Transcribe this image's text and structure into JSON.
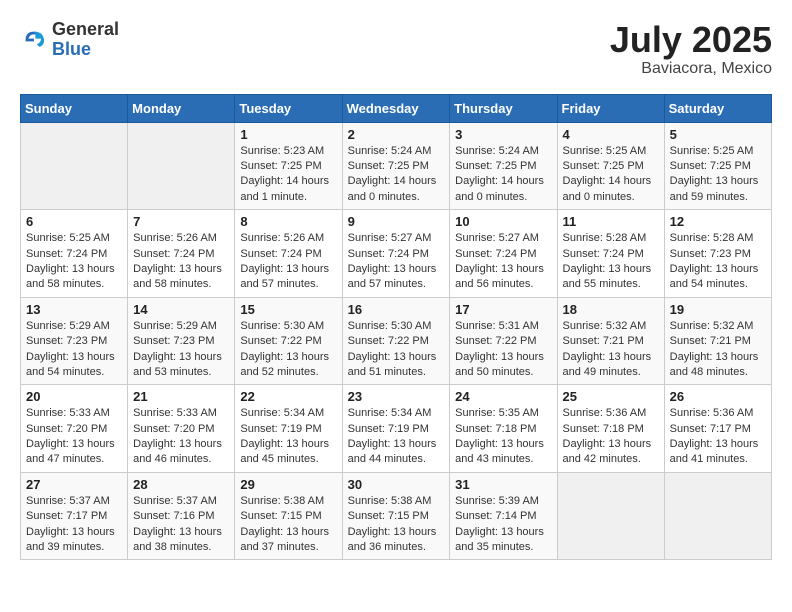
{
  "header": {
    "logo_general": "General",
    "logo_blue": "Blue",
    "title": "July 2025",
    "subtitle": "Baviacora, Mexico"
  },
  "weekdays": [
    "Sunday",
    "Monday",
    "Tuesday",
    "Wednesday",
    "Thursday",
    "Friday",
    "Saturday"
  ],
  "weeks": [
    [
      {
        "day": "",
        "info": ""
      },
      {
        "day": "",
        "info": ""
      },
      {
        "day": "1",
        "info": "Sunrise: 5:23 AM\nSunset: 7:25 PM\nDaylight: 14 hours and 1 minute."
      },
      {
        "day": "2",
        "info": "Sunrise: 5:24 AM\nSunset: 7:25 PM\nDaylight: 14 hours and 0 minutes."
      },
      {
        "day": "3",
        "info": "Sunrise: 5:24 AM\nSunset: 7:25 PM\nDaylight: 14 hours and 0 minutes."
      },
      {
        "day": "4",
        "info": "Sunrise: 5:25 AM\nSunset: 7:25 PM\nDaylight: 14 hours and 0 minutes."
      },
      {
        "day": "5",
        "info": "Sunrise: 5:25 AM\nSunset: 7:25 PM\nDaylight: 13 hours and 59 minutes."
      }
    ],
    [
      {
        "day": "6",
        "info": "Sunrise: 5:25 AM\nSunset: 7:24 PM\nDaylight: 13 hours and 58 minutes."
      },
      {
        "day": "7",
        "info": "Sunrise: 5:26 AM\nSunset: 7:24 PM\nDaylight: 13 hours and 58 minutes."
      },
      {
        "day": "8",
        "info": "Sunrise: 5:26 AM\nSunset: 7:24 PM\nDaylight: 13 hours and 57 minutes."
      },
      {
        "day": "9",
        "info": "Sunrise: 5:27 AM\nSunset: 7:24 PM\nDaylight: 13 hours and 57 minutes."
      },
      {
        "day": "10",
        "info": "Sunrise: 5:27 AM\nSunset: 7:24 PM\nDaylight: 13 hours and 56 minutes."
      },
      {
        "day": "11",
        "info": "Sunrise: 5:28 AM\nSunset: 7:24 PM\nDaylight: 13 hours and 55 minutes."
      },
      {
        "day": "12",
        "info": "Sunrise: 5:28 AM\nSunset: 7:23 PM\nDaylight: 13 hours and 54 minutes."
      }
    ],
    [
      {
        "day": "13",
        "info": "Sunrise: 5:29 AM\nSunset: 7:23 PM\nDaylight: 13 hours and 54 minutes."
      },
      {
        "day": "14",
        "info": "Sunrise: 5:29 AM\nSunset: 7:23 PM\nDaylight: 13 hours and 53 minutes."
      },
      {
        "day": "15",
        "info": "Sunrise: 5:30 AM\nSunset: 7:22 PM\nDaylight: 13 hours and 52 minutes."
      },
      {
        "day": "16",
        "info": "Sunrise: 5:30 AM\nSunset: 7:22 PM\nDaylight: 13 hours and 51 minutes."
      },
      {
        "day": "17",
        "info": "Sunrise: 5:31 AM\nSunset: 7:22 PM\nDaylight: 13 hours and 50 minutes."
      },
      {
        "day": "18",
        "info": "Sunrise: 5:32 AM\nSunset: 7:21 PM\nDaylight: 13 hours and 49 minutes."
      },
      {
        "day": "19",
        "info": "Sunrise: 5:32 AM\nSunset: 7:21 PM\nDaylight: 13 hours and 48 minutes."
      }
    ],
    [
      {
        "day": "20",
        "info": "Sunrise: 5:33 AM\nSunset: 7:20 PM\nDaylight: 13 hours and 47 minutes."
      },
      {
        "day": "21",
        "info": "Sunrise: 5:33 AM\nSunset: 7:20 PM\nDaylight: 13 hours and 46 minutes."
      },
      {
        "day": "22",
        "info": "Sunrise: 5:34 AM\nSunset: 7:19 PM\nDaylight: 13 hours and 45 minutes."
      },
      {
        "day": "23",
        "info": "Sunrise: 5:34 AM\nSunset: 7:19 PM\nDaylight: 13 hours and 44 minutes."
      },
      {
        "day": "24",
        "info": "Sunrise: 5:35 AM\nSunset: 7:18 PM\nDaylight: 13 hours and 43 minutes."
      },
      {
        "day": "25",
        "info": "Sunrise: 5:36 AM\nSunset: 7:18 PM\nDaylight: 13 hours and 42 minutes."
      },
      {
        "day": "26",
        "info": "Sunrise: 5:36 AM\nSunset: 7:17 PM\nDaylight: 13 hours and 41 minutes."
      }
    ],
    [
      {
        "day": "27",
        "info": "Sunrise: 5:37 AM\nSunset: 7:17 PM\nDaylight: 13 hours and 39 minutes."
      },
      {
        "day": "28",
        "info": "Sunrise: 5:37 AM\nSunset: 7:16 PM\nDaylight: 13 hours and 38 minutes."
      },
      {
        "day": "29",
        "info": "Sunrise: 5:38 AM\nSunset: 7:15 PM\nDaylight: 13 hours and 37 minutes."
      },
      {
        "day": "30",
        "info": "Sunrise: 5:38 AM\nSunset: 7:15 PM\nDaylight: 13 hours and 36 minutes."
      },
      {
        "day": "31",
        "info": "Sunrise: 5:39 AM\nSunset: 7:14 PM\nDaylight: 13 hours and 35 minutes."
      },
      {
        "day": "",
        "info": ""
      },
      {
        "day": "",
        "info": ""
      }
    ]
  ]
}
